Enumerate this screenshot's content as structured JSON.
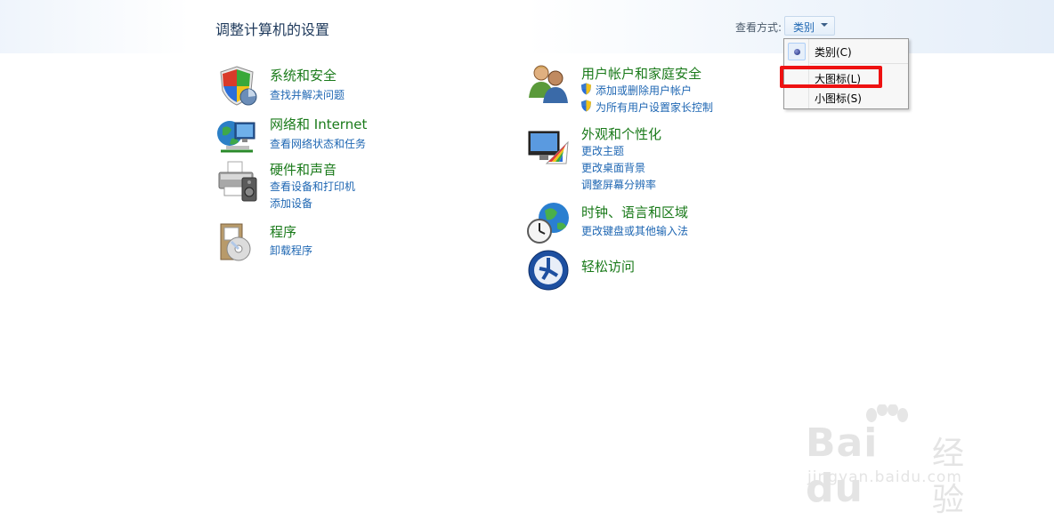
{
  "page": {
    "title": "调整计算机的设置"
  },
  "view_by": {
    "label": "查看方式:",
    "value": "类别"
  },
  "menu": {
    "items": [
      {
        "label": "类别(C)",
        "selected": true
      },
      {
        "label": "大图标(L)",
        "selected": false
      },
      {
        "label": "小图标(S)",
        "selected": false
      }
    ],
    "highlight_color": "#ee1111"
  },
  "categories_left": [
    {
      "title": "系统和安全",
      "icon": "shield-icon",
      "links": [
        "查找并解决问题"
      ]
    },
    {
      "title": "网络和 Internet",
      "icon": "network-icon",
      "links": [
        "查看网络状态和任务"
      ]
    },
    {
      "title": "硬件和声音",
      "icon": "printer-icon",
      "links": [
        "查看设备和打印机",
        "添加设备"
      ]
    },
    {
      "title": "程序",
      "icon": "programs-icon",
      "links": [
        "卸载程序"
      ]
    }
  ],
  "categories_right": [
    {
      "title": "用户帐户和家庭安全",
      "icon": "users-icon",
      "links": [
        "添加或删除用户帐户",
        "为所有用户设置家长控制"
      ]
    },
    {
      "title": "外观和个性化",
      "icon": "appearance-icon",
      "links": [
        "更改主题",
        "更改桌面背景",
        "调整屏幕分辨率"
      ]
    },
    {
      "title": "时钟、语言和区域",
      "icon": "clock-globe-icon",
      "links": [
        "更改键盘或其他输入法"
      ]
    },
    {
      "title": "轻松访问",
      "icon": "ease-of-access-icon",
      "links": []
    }
  ],
  "watermark": {
    "brand": "Bai du",
    "suffix": "经验",
    "url": "jingyan.baidu.com"
  },
  "colors": {
    "title_green": "#1a7a1a",
    "link_blue": "#1f67b3",
    "heading_navy": "#1e395b"
  }
}
